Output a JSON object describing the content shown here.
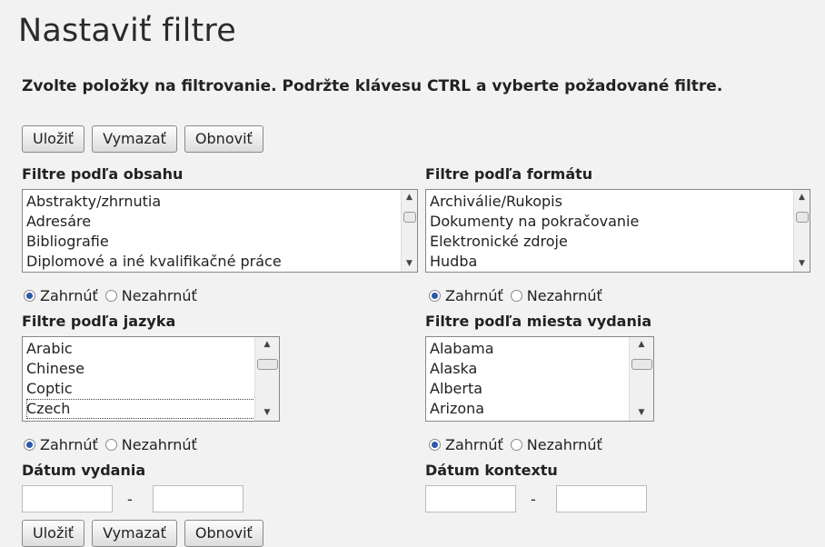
{
  "title": "Nastaviť filtre",
  "instructions": "Zvolte položky na filtrovanie. Podržte klávesu CTRL a vyberte požadované filtre.",
  "buttons": {
    "save": "Uložiť",
    "clear": "Vymazať",
    "reset": "Obnoviť"
  },
  "content_filter": {
    "label": "Filtre podľa obsahu",
    "items": [
      "Abstrakty/zhrnutia",
      "Adresáre",
      "Bibliografie",
      "Diplomové a iné kvalifikačné práce"
    ],
    "include": "Zahrnúť",
    "exclude": "Nezahrnúť",
    "selected": "include"
  },
  "format_filter": {
    "label": "Filtre podľa formátu",
    "items": [
      "Archiválie/Rukopis",
      "Dokumenty na pokračovanie",
      "Elektronické zdroje",
      "Hudba"
    ],
    "include": "Zahrnúť",
    "exclude": "Nezahrnúť",
    "selected": "include"
  },
  "language_filter": {
    "label": "Filtre podľa jazyka",
    "items": [
      "Arabic",
      "Chinese",
      "Coptic",
      "Czech"
    ],
    "include": "Zahrnúť",
    "exclude": "Nezahrnúť",
    "selected": "include"
  },
  "place_filter": {
    "label": "Filtre podľa miesta vydania",
    "items": [
      "Alabama",
      "Alaska",
      "Alberta",
      "Arizona"
    ],
    "include": "Zahrnúť",
    "exclude": "Nezahrnúť",
    "selected": "include"
  },
  "publication_date": {
    "label": "Dátum vydania",
    "from": "",
    "to": "",
    "separator": "-"
  },
  "context_date": {
    "label": "Dátum kontextu",
    "from": "",
    "to": "",
    "separator": "-"
  }
}
